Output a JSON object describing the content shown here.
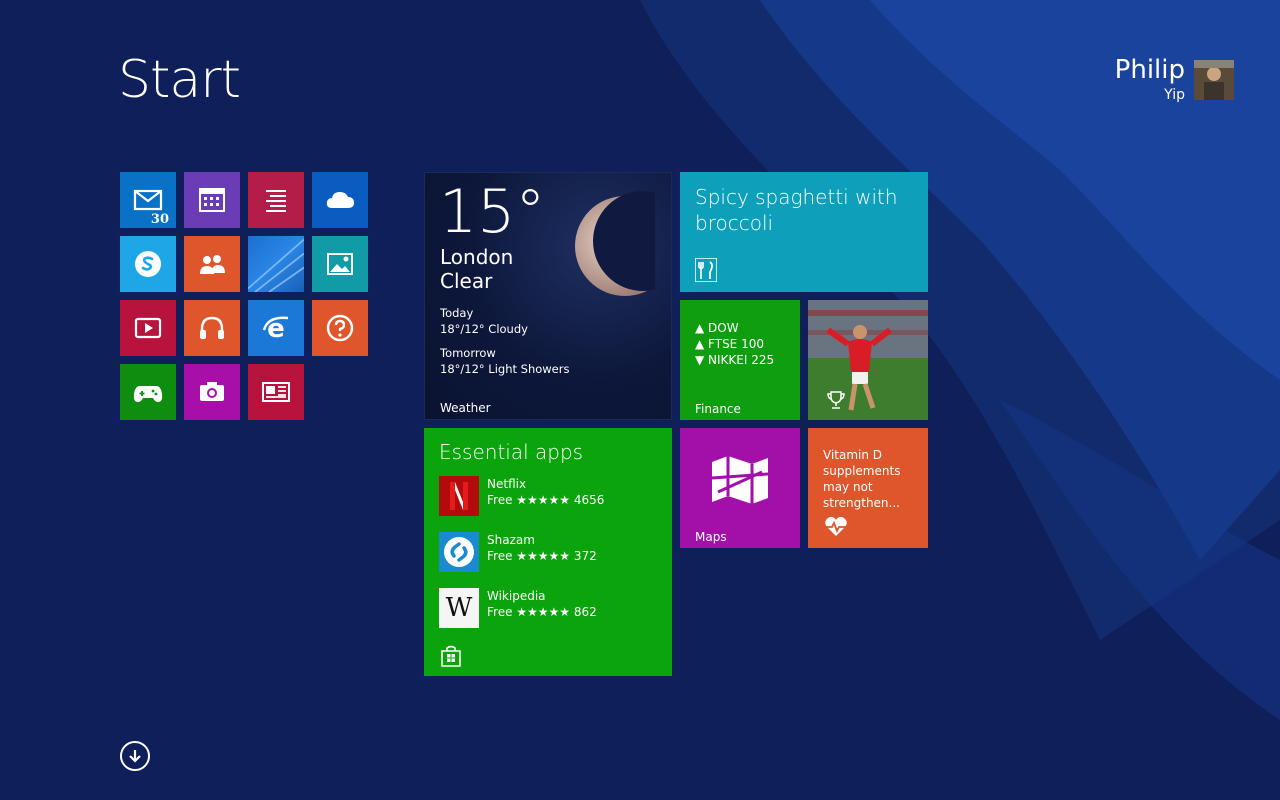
{
  "header": {
    "title": "Start",
    "user_first_name": "Philip",
    "user_last_name": "Yip"
  },
  "small_tiles": [
    {
      "name": "mail",
      "icon": "mail-icon",
      "color": "#0a72c6",
      "badge": "30"
    },
    {
      "name": "calendar",
      "icon": "calendar-icon",
      "color": "#6a3cb5"
    },
    {
      "name": "reading-list",
      "icon": "reading-list-icon",
      "color": "#b31d48"
    },
    {
      "name": "onedrive",
      "icon": "cloud-icon",
      "color": "#0a5cc0"
    },
    {
      "name": "skype",
      "icon": "skype-icon",
      "color": "#1fa6e6"
    },
    {
      "name": "people",
      "icon": "people-icon",
      "color": "#e0562c"
    },
    {
      "name": "desktop",
      "icon": "desktop-wallpaper-icon",
      "color": "#1a70c8"
    },
    {
      "name": "photos",
      "icon": "photos-icon",
      "color": "#109ba6"
    },
    {
      "name": "video",
      "icon": "video-icon",
      "color": "#b8133c"
    },
    {
      "name": "music",
      "icon": "headphones-icon",
      "color": "#e0562c"
    },
    {
      "name": "internet-explorer",
      "icon": "internet-explorer-icon",
      "color": "#1b78d6"
    },
    {
      "name": "help-tips",
      "icon": "help-icon",
      "color": "#e0562c"
    },
    {
      "name": "games",
      "icon": "game-controller-icon",
      "color": "#0f8d0f"
    },
    {
      "name": "camera",
      "icon": "camera-icon",
      "color": "#a80fa9"
    },
    {
      "name": "news",
      "icon": "news-icon",
      "color": "#b8133c"
    }
  ],
  "weather": {
    "temperature": "15°",
    "city": "London",
    "condition": "Clear",
    "today_label": "Today",
    "today_forecast": "18°/12° Cloudy",
    "tomorrow_label": "Tomorrow",
    "tomorrow_forecast": "18°/12° Light Showers",
    "app_label": "Weather"
  },
  "recipe": {
    "text": "Spicy spaghetti with broccoli",
    "icon": "fork-knife-icon",
    "color": "#0ea0bb"
  },
  "finance": {
    "lines": [
      "▲ DOW",
      "▲ FTSE 100",
      "▼ NIKKEI 225"
    ],
    "app_label": "Finance"
  },
  "sport": {
    "icon": "trophy-icon"
  },
  "store": {
    "heading": "Essential apps",
    "apps": [
      {
        "name": "Netflix",
        "meta": "Free ★★★★★ 4656",
        "icon": "netflix-icon"
      },
      {
        "name": "Shazam",
        "meta": "Free ★★★★★ 372",
        "icon": "shazam-icon"
      },
      {
        "name": "Wikipedia",
        "meta": "Free ★★★★★ 862",
        "icon": "wikipedia-icon"
      }
    ],
    "icon": "store-bag-icon"
  },
  "maps": {
    "app_label": "Maps",
    "icon": "map-icon"
  },
  "health": {
    "text": "Vitamin D supplements may not strengthen...",
    "icon": "heart-pulse-icon"
  },
  "footer": {
    "all_apps_icon": "down-arrow-icon"
  }
}
